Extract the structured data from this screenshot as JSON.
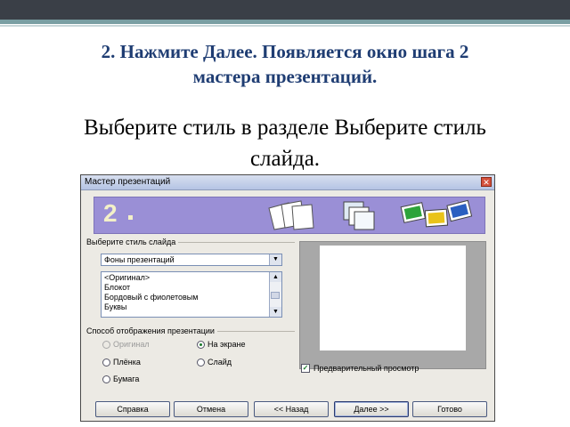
{
  "slide": {
    "heading_line1": "2. Нажмите Далее. Появляется окно шага 2",
    "heading_line2": "мастера презентаций.",
    "body_line1": "Выберите стиль в разделе Выберите стиль",
    "body_line2": "слайда."
  },
  "dialog": {
    "title": "Мастер презентаций",
    "close_glyph": "✕",
    "step_number": "2",
    "style_group_label": "Выберите стиль слайда",
    "style_category": "Фоны презентаций",
    "style_list": [
      "<Оригинал>",
      "Блокот",
      "Бордовый с фиолетовым",
      "Буквы"
    ],
    "display_group_label": "Способ отображения презентации",
    "radios": {
      "original": "Оригинал",
      "screen": "На экране",
      "film": "Плёнка",
      "slide": "Слайд",
      "paper": "Бумага"
    },
    "preview_label": "Предварительный просмотр",
    "buttons": {
      "help": "Справка",
      "cancel": "Отмена",
      "back": "<< Назад",
      "next": "Далее >>",
      "done": "Готово"
    }
  },
  "colors": {
    "heading": "#1f3d73",
    "banner": "#9a8fd6",
    "radio_checked": "#1a7a2a"
  },
  "icons": [
    "combo-arrow-icon",
    "scroll-up-icon",
    "scroll-down-icon",
    "check-icon",
    "close-icon",
    "pages-icon",
    "layers-icon",
    "slides-icon"
  ]
}
